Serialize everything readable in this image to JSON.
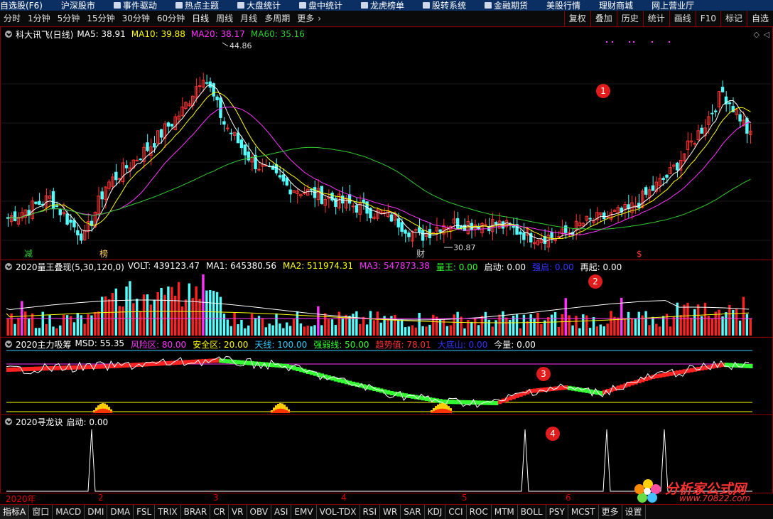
{
  "topnav": [
    {
      "label": "自选股(F6)",
      "icon": ""
    },
    {
      "label": "沪深股市",
      "icon": ""
    },
    {
      "label": "事件驱动",
      "icon": "doc-icon"
    },
    {
      "label": "热点主题",
      "icon": "fire-icon"
    },
    {
      "label": "大盘统计",
      "icon": "chart-icon"
    },
    {
      "label": "盘中统计",
      "icon": "monitor-icon"
    },
    {
      "label": "龙虎榜单",
      "icon": "dragon-icon"
    },
    {
      "label": "股转系统",
      "icon": "transfer-icon"
    },
    {
      "label": "金融期货",
      "icon": "futures-icon"
    },
    {
      "label": "美股行情",
      "icon": ""
    },
    {
      "label": "理财商城",
      "icon": ""
    },
    {
      "label": "网上营业厅",
      "icon": ""
    }
  ],
  "periods": [
    "分时",
    "1分钟",
    "5分钟",
    "15分钟",
    "30分钟",
    "60分钟",
    "日线",
    "周线",
    "月线",
    "多周期",
    "更多"
  ],
  "active_period": "日线",
  "right_tools": [
    "复权",
    "叠加",
    "历史",
    "统计",
    "画线",
    "F10",
    "标记",
    "自选"
  ],
  "main": {
    "stock": "科大讯飞(日线)",
    "ma": [
      {
        "label": "MA5: 38.91",
        "color": "#ffffff"
      },
      {
        "label": "MA10: 39.88",
        "color": "#ffff00"
      },
      {
        "label": "MA20: 38.17",
        "color": "#ff33ff"
      },
      {
        "label": "MA60: 35.16",
        "color": "#33cc33"
      }
    ],
    "high_label": "44.86",
    "low_label": "30.87",
    "badge": "1",
    "markers": [
      {
        "text": "减",
        "color": "#33cc33"
      },
      {
        "text": "榜",
        "color": "#ffcc66"
      },
      {
        "text": "财",
        "color": "#cccccc"
      },
      {
        "text": "$",
        "color": "#ff3333"
      }
    ]
  },
  "pane2": {
    "title": "2020量王叠现(5,30,120,0)",
    "items": [
      {
        "label": "VOLT: 439123.47",
        "color": "#ffffff"
      },
      {
        "label": "MA1: 645380.56",
        "color": "#ffffff"
      },
      {
        "label": "MA2: 511974.31",
        "color": "#ffff00"
      },
      {
        "label": "MA3: 547873.38",
        "color": "#ff33ff"
      },
      {
        "label": "量王: 0.00",
        "color": "#33ff33"
      },
      {
        "label": "启动: 0.00",
        "color": "#ffffff"
      },
      {
        "label": "强启: 0.00",
        "color": "#3333ff"
      },
      {
        "label": "再起: 0.00",
        "color": "#ffffff"
      }
    ],
    "badge": "2"
  },
  "pane3": {
    "title": "2020主力吸筹",
    "items": [
      {
        "label": "MSD: 55.35",
        "color": "#ffffff"
      },
      {
        "label": "风险区: 80.00",
        "color": "#ff33ff"
      },
      {
        "label": "安全区: 20.00",
        "color": "#ffff00"
      },
      {
        "label": "天线: 100.00",
        "color": "#33ccff"
      },
      {
        "label": "强弱线: 50.00",
        "color": "#33ff33"
      },
      {
        "label": "趋势值: 78.01",
        "color": "#ff3333"
      },
      {
        "label": "大底山: 0.00",
        "color": "#3333ff"
      },
      {
        "label": "今量: 0.00",
        "color": "#ffffff"
      }
    ],
    "badge": "3"
  },
  "pane4": {
    "title": "2020寻龙诀",
    "items": [
      {
        "label": "启动: 0.00",
        "color": "#ffffff"
      }
    ],
    "badge": "4"
  },
  "xaxis": [
    "2020年",
    "2",
    "3",
    "4",
    "5",
    "6"
  ],
  "logo": {
    "name": "分析家公式网",
    "url": "www.70822.com"
  },
  "tabs": [
    "指标A",
    "窗口",
    "MACD",
    "DMI",
    "DMA",
    "FSL",
    "TRIX",
    "BRAR",
    "CR",
    "VR",
    "OBV",
    "ASI",
    "EMV",
    "VOL-TDX",
    "RSI",
    "WR",
    "SAR",
    "KDJ",
    "CCI",
    "ROC",
    "MTM",
    "BOLL",
    "PSY",
    "MCST",
    "更多",
    "设置"
  ]
}
